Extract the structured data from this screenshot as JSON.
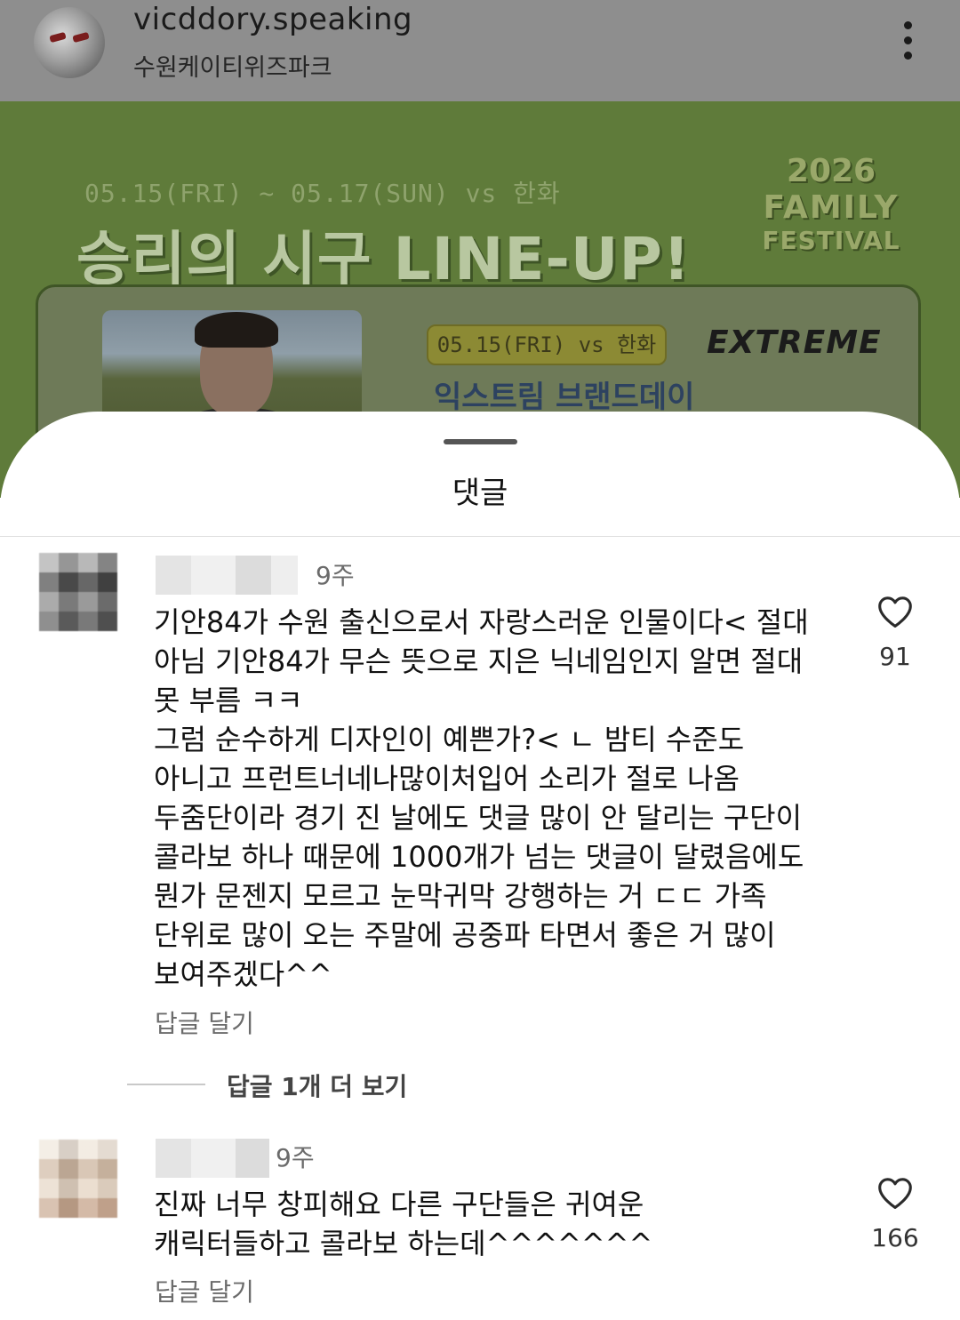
{
  "post": {
    "username": "vicddory.speaking",
    "location": "수원케이티위즈파크",
    "banner": {
      "date_range": "05.15(FRI) ~ 05.17(SUN) vs 한화",
      "headline": "승리의 시구 LINE-UP!",
      "logo_year": "2026",
      "logo_line1": "FAMILY",
      "logo_line2": "FESTIVAL",
      "game_date": "05.15(FRI) vs 한화",
      "brand_day": "익스트림 브랜드데이",
      "sponsor": "EXTREME"
    }
  },
  "sheet": {
    "title": "댓글"
  },
  "comments": [
    {
      "time": "9주",
      "text": "기안84가 수원 출신으로서 자랑스러운 인물이다< 절대\n아님 기안84가 무슨 뜻으로 지은 닉네임인지 알면 절대\n못 부름 ㅋㅋ\n그럼 순수하게 디자인이 예쁜가?< ㄴ 밤티 수준도\n아니고 프런트너네나많이처입어 소리가 절로 나옴\n두줌단이라 경기 진 날에도 댓글 많이 안 달리는 구단이\n콜라보 하나 때문에 1000개가 넘는 댓글이 달렸음에도\n뭔가 문젠지 모르고 눈막귀막 강행하는 거 ㄷㄷ 가족\n단위로 많이 오는 주말에 공중파 타면서 좋은 거 많이\n보여주겠다^^",
      "reply_label": "답글 달기",
      "likes": "91"
    },
    {
      "time": "9주",
      "text": "진짜 너무 창피해요 다른 구단들은 귀여운\n캐릭터들하고 콜라보 하는데^^^^^^^",
      "reply_label": "답글 달기",
      "likes": "166"
    }
  ],
  "view_more_replies": "답글 1개 더 보기",
  "colors": {
    "banner_green": "#5f7b3a",
    "header_overlay": "#8e8e8e",
    "muted_text": "#6b6b6b"
  },
  "icons": {
    "more": "more-vertical-icon",
    "like": "heart-icon"
  }
}
